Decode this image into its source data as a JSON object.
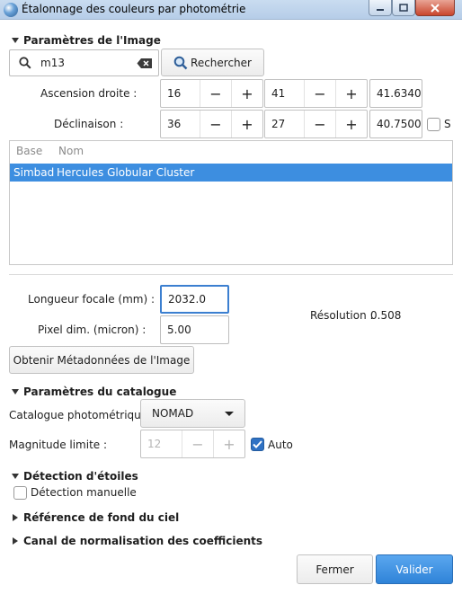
{
  "window": {
    "title": "Étalonnage des couleurs par photométrie"
  },
  "image_section": {
    "header": "Paramètres de l'Image",
    "search": {
      "value": "m13",
      "button_label": "Rechercher"
    },
    "ra": {
      "label": "Ascension droite :",
      "h": "16",
      "m": "41",
      "s": "41.6340"
    },
    "dec": {
      "label": "Déclinaison :",
      "d": "36",
      "m": "27",
      "s": "40.7500",
      "south_label": "S"
    },
    "table": {
      "columns": [
        "Base",
        "Nom"
      ],
      "rows": [
        {
          "base": "Simbad",
          "nom": "Hercules Globular Cluster"
        }
      ]
    },
    "focal": {
      "label": "Longueur focale (mm) :",
      "value": "2032.0"
    },
    "pixel": {
      "label": "Pixel dim. (micron) :",
      "value": "5.00"
    },
    "resolution": {
      "label": "Résolution :",
      "value": "0.508"
    },
    "metadata_button": "Obtenir Métadonnées de l'Image"
  },
  "catalog_section": {
    "header": "Paramètres du catalogue",
    "catalog": {
      "label": "Catalogue photométrique :",
      "value": "NOMAD"
    },
    "magnitude": {
      "label": "Magnitude limite :",
      "value": "12",
      "auto_label": "Auto",
      "auto_checked": true
    }
  },
  "star_section": {
    "header": "Détection d'étoiles",
    "manual_label": "Détection manuelle"
  },
  "background_section": {
    "header": "Référence de fond du ciel"
  },
  "normalization_section": {
    "header": "Canal de normalisation des coefficients"
  },
  "footer": {
    "cancel": "Fermer",
    "ok": "Valider"
  },
  "spin": {
    "minus": "−",
    "plus": "+"
  },
  "colors": {
    "selection": "#3d8ee0",
    "primary_button": "#2f83d8",
    "checkbox_checked": "#2f72c4"
  }
}
